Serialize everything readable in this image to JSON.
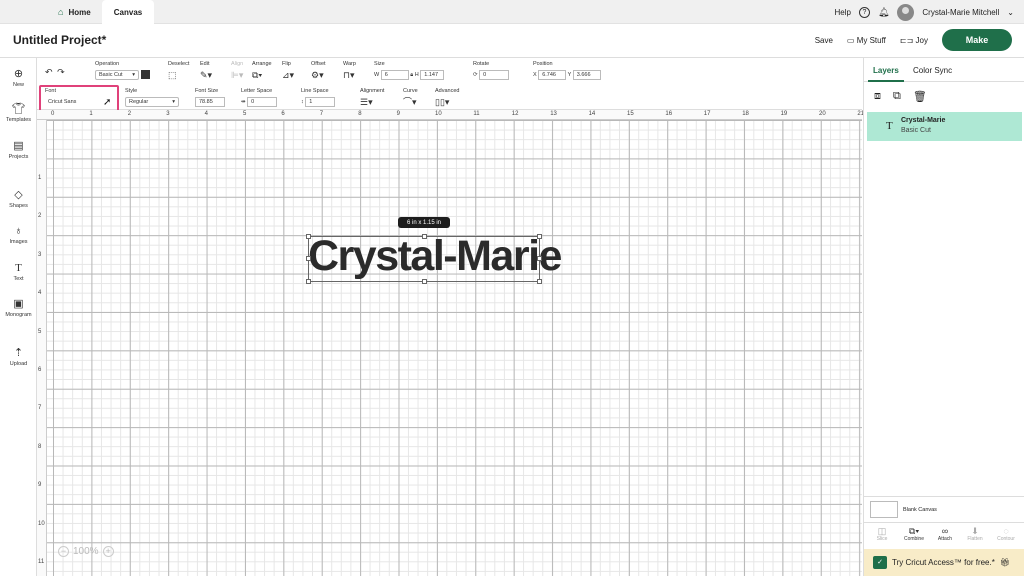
{
  "topbar": {
    "home_label": "Home",
    "canvas_label": "Canvas",
    "help_label": "Help",
    "help_icon": "?",
    "user_name": "Crystal-Marie Mitchell"
  },
  "project": {
    "title": "Untitled Project*",
    "save_label": "Save",
    "mystuff_label": "My Stuff",
    "joy_label": "Joy",
    "make_label": "Make"
  },
  "leftnav": {
    "new": "New",
    "templates": "Templates",
    "projects": "Projects",
    "shapes": "Shapes",
    "images": "Images",
    "text": "Text",
    "text_icon": "T",
    "monogram": "Monogram",
    "upload": "Upload"
  },
  "toolbar": {
    "operation_label": "Operation",
    "operation_value": "Basic Cut",
    "deselect_label": "Deselect",
    "edit_label": "Edit",
    "align_label": "Align",
    "arrange_label": "Arrange",
    "flip_label": "Flip",
    "offset_label": "Offset",
    "warp_label": "Warp",
    "size_label": "Size",
    "w_label": "W",
    "w_value": "6",
    "h_label": "H",
    "h_value": "1.147",
    "rotate_label": "Rotate",
    "rotate_value": "0",
    "position_label": "Position",
    "x_label": "X",
    "x_value": "6.746",
    "y_label": "Y",
    "y_value": "3.666",
    "font_label": "Font",
    "font_value": "Cricut Sans",
    "style_label": "Style",
    "style_value": "Regular",
    "fontsize_label": "Font Size",
    "fontsize_value": "78.85",
    "letterspace_label": "Letter Space",
    "letterspace_value": "0",
    "linespace_label": "Line Space",
    "linespace_value": "1",
    "alignment_label": "Alignment",
    "curve_label": "Curve",
    "advanced_label": "Advanced"
  },
  "ruler": {
    "top": [
      "0",
      "1",
      "2",
      "3",
      "4",
      "5",
      "6",
      "7",
      "8",
      "9",
      "10",
      "11",
      "12",
      "13",
      "14",
      "15",
      "16",
      "17",
      "18",
      "19",
      "20",
      "21"
    ],
    "left": [
      "1",
      "2",
      "3",
      "4",
      "5",
      "6",
      "7",
      "8",
      "9",
      "10",
      "11"
    ]
  },
  "canvas": {
    "dimension_label": "6  in x 1.15  in",
    "design_text": "Crystal-Marie",
    "zoom_value": "100%"
  },
  "rightpanel": {
    "tab_layers": "Layers",
    "tab_colorsync": "Color Sync",
    "layer_icon": "T",
    "layer_name": "Crystal-Marie",
    "layer_operation": "Basic Cut",
    "blank_canvas_label": "Blank Canvas",
    "actions": {
      "slice": "Slice",
      "combine": "Combine",
      "attach": "Attach",
      "flatten": "Flatten",
      "contour": "Contour"
    },
    "promo_text": "Try Cricut Access™ for free.*"
  },
  "colors": {
    "accent": "#1f6f4a",
    "highlight": "#e0417a",
    "layer_bg": "#aee8d4"
  }
}
